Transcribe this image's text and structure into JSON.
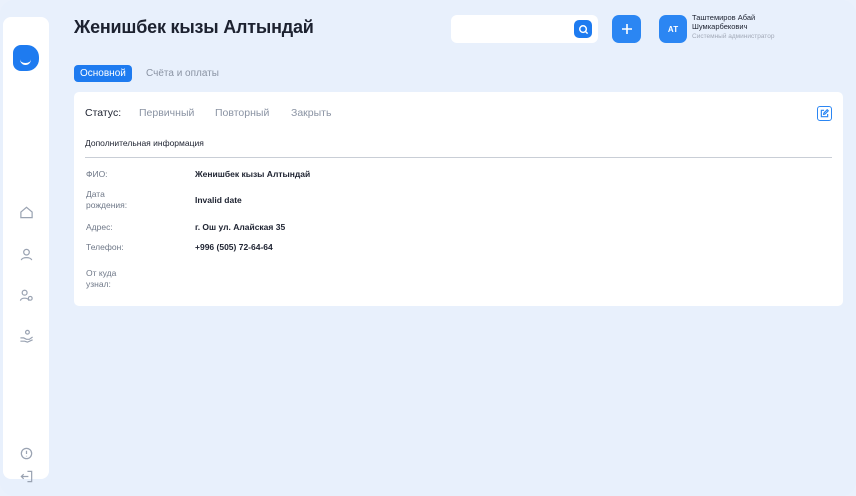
{
  "header": {
    "title": "Женишбек кызы Алтындай",
    "search": {
      "value": "",
      "placeholder": ""
    },
    "user": {
      "initials": "АТ",
      "name": "Таштемиров Абай Шумкарбекович",
      "role": "Системный администратор"
    }
  },
  "tabs": [
    {
      "label": "Основной",
      "active": true
    },
    {
      "label": "Счёта и оплаты",
      "active": false
    }
  ],
  "status": {
    "label": "Статус:",
    "options": [
      "Первичный",
      "Повторный",
      "Закрыть"
    ]
  },
  "section": {
    "title": "Дополнительная информация"
  },
  "fields": [
    {
      "label": "ФИО:",
      "value": "Женишбек кызы Алтындай"
    },
    {
      "label": "Дата рождения:",
      "value": "Invalid date"
    },
    {
      "label": "Адрес:",
      "value": "г. Ош ул. Алайская 35"
    },
    {
      "label": "Телефон:",
      "value": "+996 (505) 72-64-64"
    },
    {
      "label": "От куда узнал:",
      "value": ""
    }
  ],
  "sidebar": {
    "icons": [
      "logo-icon",
      "home-icon",
      "user-icon",
      "users-icon",
      "handshake-icon",
      "info-icon",
      "logout-icon"
    ]
  },
  "colors": {
    "accent": "#1e7bf0",
    "background": "#e8f0fc",
    "card": "#ffffff",
    "muted_text": "#8a93a3"
  }
}
